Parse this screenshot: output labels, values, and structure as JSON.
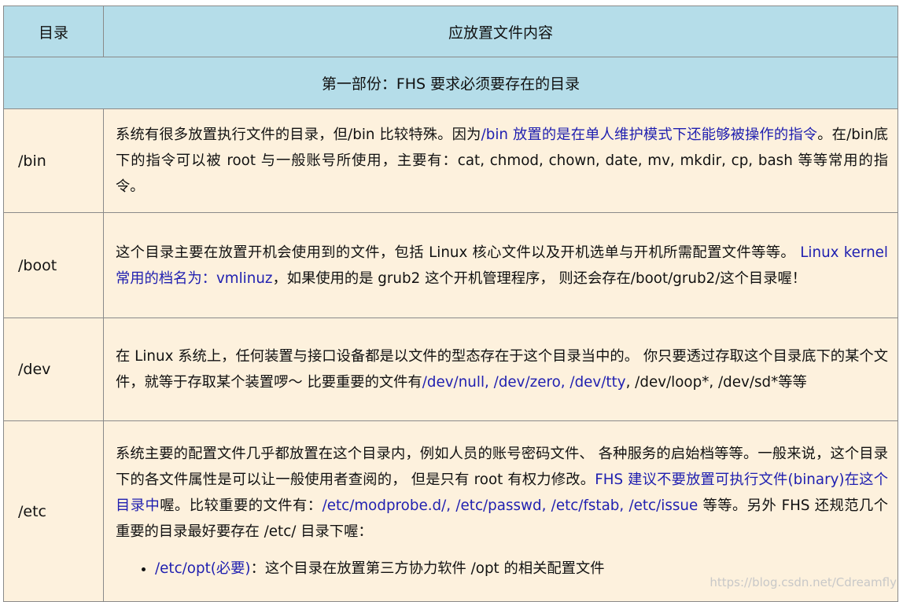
{
  "header": {
    "col_dir": "目录",
    "col_content": "应放置文件内容"
  },
  "section_title": "第一部份：FHS 要求必须要存在的目录",
  "rows": [
    {
      "dir": "/bin",
      "parts": [
        {
          "text": "系统有很多放置执行文件的目录，但/bin 比较特殊。因为",
          "blue": false
        },
        {
          "text": "/bin 放置的是在单人维护模式下还能够被操作的指令",
          "blue": true
        },
        {
          "text": "。在/bin底下的指令可以被 root 与一般账号所使用，主要有：cat, chmod, chown, date, mv, mkdir, cp, bash 等等常用的指令。",
          "blue": false
        }
      ]
    },
    {
      "dir": "/boot",
      "parts": [
        {
          "text": "这个目录主要在放置开机会使用到的文件，包括 Linux 核心文件以及开机选单与开机所需配置文件等等。 ",
          "blue": false
        },
        {
          "text": "Linux kernel 常用的档名为：vmlinuz",
          "blue": true
        },
        {
          "text": "，如果使用的是 grub2 这个开机管理程序， 则还会存在/boot/grub2/这个目录喔！",
          "blue": false
        }
      ]
    },
    {
      "dir": "/dev",
      "parts": [
        {
          "text": "在 Linux 系统上，任何装置与接口设备都是以文件的型态存在于这个目录当中的。 你只要透过存取这个目录底下的某个文件，就等于存取某个装置啰～ 比要重要的文件有",
          "blue": false
        },
        {
          "text": "/dev/null, /dev/zero, /dev/tty",
          "blue": true
        },
        {
          "text": ", /dev/loop*, /dev/sd*等等",
          "blue": false
        }
      ]
    },
    {
      "dir": "/etc",
      "parts": [
        {
          "text": "系统主要的配置文件几乎都放置在这个目录内，例如人员的账号密码文件、 各种服务的启始档等等。一般来说，这个目录下的各文件属性是可以让一般使用者查阅的， 但是只有 root 有权力修改。",
          "blue": false
        },
        {
          "text": "FHS 建议不要放置可执行文件(binary)在这个目录中",
          "blue": true
        },
        {
          "text": "喔。比较重要的文件有：",
          "blue": false
        },
        {
          "text": "/etc/modprobe.d/, /etc/passwd, /etc/fstab, /etc/issue",
          "blue": true
        },
        {
          "text": " 等等。另外 FHS 还规范几个重要的目录最好要存在 /etc/ 目录下喔：",
          "blue": false
        }
      ],
      "bullets": [
        {
          "blue_text": "/etc/opt(必要)",
          "text": "：这个目录在放置第三方协力软件 /opt 的相关配置文件"
        }
      ]
    }
  ],
  "watermark": "https://blog.csdn.net/Cdreamfly"
}
